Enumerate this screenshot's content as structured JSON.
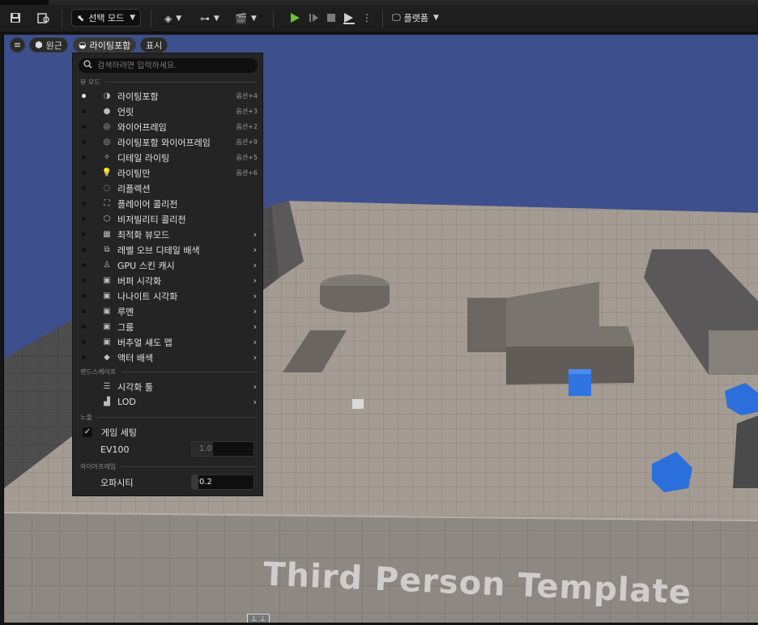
{
  "toolbar": {
    "mode_label": "선택 모드",
    "platform_label": "플랫폼",
    "icons": [
      "save-icon",
      "content-browser-icon",
      "select-mode-icon",
      "add-actor-icon",
      "blueprint-icon",
      "cinematics-icon",
      "play-icon",
      "advance-frame-icon",
      "stop-icon",
      "eject-icon",
      "more-icon",
      "platforms-icon"
    ],
    "play_color": "#6cc03a"
  },
  "viewport": {
    "hamburger_icon": "menu-icon",
    "perspective_label": "원근",
    "viewmode_label": "라이팅포함",
    "show_label": "표시",
    "sky_color": "#3d4f8d",
    "watermark": "Third Person Template"
  },
  "menu": {
    "search_placeholder": "검색하려면 입력하세요.",
    "sections": {
      "view_mode": "뷰 모드",
      "landscape": "랜드스케이프",
      "exposure": "노출",
      "wireframe": "와이어프레임"
    },
    "view_modes": [
      {
        "label": "라이팅포함",
        "shortcut": "옵션+4",
        "selected": true,
        "icon": "lit-sphere-icon"
      },
      {
        "label": "언릿",
        "shortcut": "옵션+3",
        "icon": "unlit-sphere-icon"
      },
      {
        "label": "와이어프레임",
        "shortcut": "옵션+2",
        "icon": "wireframe-sphere-icon"
      },
      {
        "label": "라이팅포함 와이어프레임",
        "shortcut": "옵션+9",
        "icon": "lit-wireframe-icon"
      },
      {
        "label": "디테일 라이팅",
        "shortcut": "옵션+5",
        "icon": "detail-lighting-icon"
      },
      {
        "label": "라이팅만",
        "shortcut": "옵션+6",
        "icon": "bulb-icon"
      },
      {
        "label": "리플렉션",
        "shortcut": "",
        "icon": "reflection-icon"
      },
      {
        "label": "플레이어 콜리전",
        "shortcut": "",
        "icon": "player-collision-icon"
      },
      {
        "label": "비저빌리티 콜리전",
        "shortcut": "",
        "icon": "visibility-collision-icon"
      },
      {
        "label": "최적화 뷰모드",
        "shortcut": "",
        "submenu": true,
        "icon": "optimization-icon"
      },
      {
        "label": "레벨 오브 디테일 배색",
        "shortcut": "",
        "submenu": true,
        "icon": "lod-coloration-icon"
      },
      {
        "label": "GPU 스킨 캐시",
        "shortcut": "",
        "submenu": true,
        "icon": "gpu-skin-icon"
      },
      {
        "label": "버퍼 시각화",
        "shortcut": "",
        "submenu": true,
        "icon": "buffer-icon"
      },
      {
        "label": "나나이트 시각화",
        "shortcut": "",
        "submenu": true,
        "icon": "nanite-icon"
      },
      {
        "label": "루멘",
        "shortcut": "",
        "submenu": true,
        "icon": "lumen-icon"
      },
      {
        "label": "그룸",
        "shortcut": "",
        "submenu": true,
        "icon": "groom-icon"
      },
      {
        "label": "버추얼 섀도 맵",
        "shortcut": "",
        "submenu": true,
        "icon": "vsm-icon"
      },
      {
        "label": "액터 배색",
        "shortcut": "",
        "submenu": true,
        "icon": "actor-coloration-icon"
      }
    ],
    "landscape_items": [
      {
        "label": "시각화 툴",
        "icon": "visualizer-icon"
      },
      {
        "label": "LOD",
        "icon": "lod-icon"
      }
    ],
    "exposure": {
      "game_settings_label": "게임 세팅",
      "game_settings_checked": true,
      "ev100_label": "EV100",
      "ev100_value": "1.0"
    },
    "wireframe": {
      "opacity_label": "오파시티",
      "opacity_value": "0.2",
      "opacity_fraction": 0.2
    }
  }
}
